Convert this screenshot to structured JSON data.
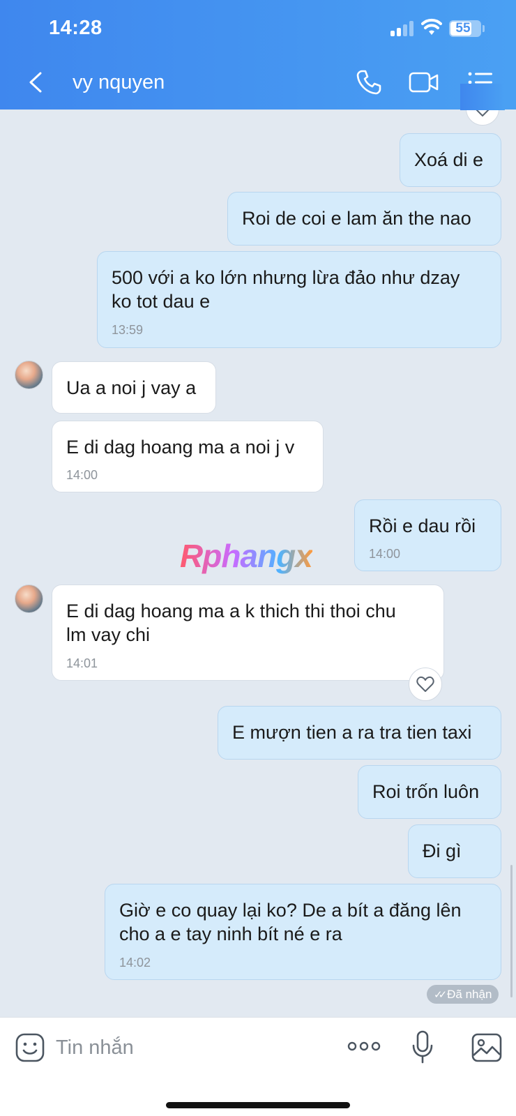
{
  "status_bar": {
    "time": "14:28",
    "battery": "55"
  },
  "header": {
    "contact_name": "vy nquyen"
  },
  "messages": [
    {
      "id": "m1",
      "text": "Xoá di e"
    },
    {
      "id": "m2",
      "text": "Roi de coi e lam ăn the nao"
    },
    {
      "id": "m3",
      "text_line1": "500 với a ko lớn nhưng lừa đảo như dzay",
      "text_line2": "ko tot dau e",
      "time": "13:59"
    },
    {
      "id": "m4",
      "text": "Ua a noi j vay a"
    },
    {
      "id": "m5",
      "text": "E di dag hoang ma a noi j v",
      "time": "14:00"
    },
    {
      "id": "m6",
      "text": "Rồi e dau rồi",
      "time": "14:00"
    },
    {
      "id": "m7",
      "text_line1": "E di dag hoang ma a k thich thi thoi chu",
      "text_line2": "lm vay chi",
      "time": "14:01"
    },
    {
      "id": "m8",
      "text": "E mượn tien a ra tra tien taxi"
    },
    {
      "id": "m9",
      "text": "Roi trốn luôn"
    },
    {
      "id": "m10",
      "text": "Đi gì"
    },
    {
      "id": "m11",
      "text_line1": "Giờ e co quay lại ko? De a bít a đăng lên",
      "text_line2": "cho a e tay ninh bít né e ra",
      "time": "14:02"
    }
  ],
  "receipt": {
    "status": "Đã nhận"
  },
  "watermark": {
    "text": "Rphangx"
  },
  "composer": {
    "placeholder": "Tin nhắn"
  },
  "colors": {
    "header_start": "#3f87ee",
    "header_end": "#4aa0f3",
    "outgoing_bubble": "#d5ebfb",
    "incoming_bubble": "#ffffff",
    "chat_background": "#e2e9f1"
  },
  "icons": [
    "back-icon",
    "phone-icon",
    "video-icon",
    "menu-icon",
    "heart-icon",
    "emoji-icon",
    "more-icon",
    "microphone-icon",
    "image-icon"
  ]
}
